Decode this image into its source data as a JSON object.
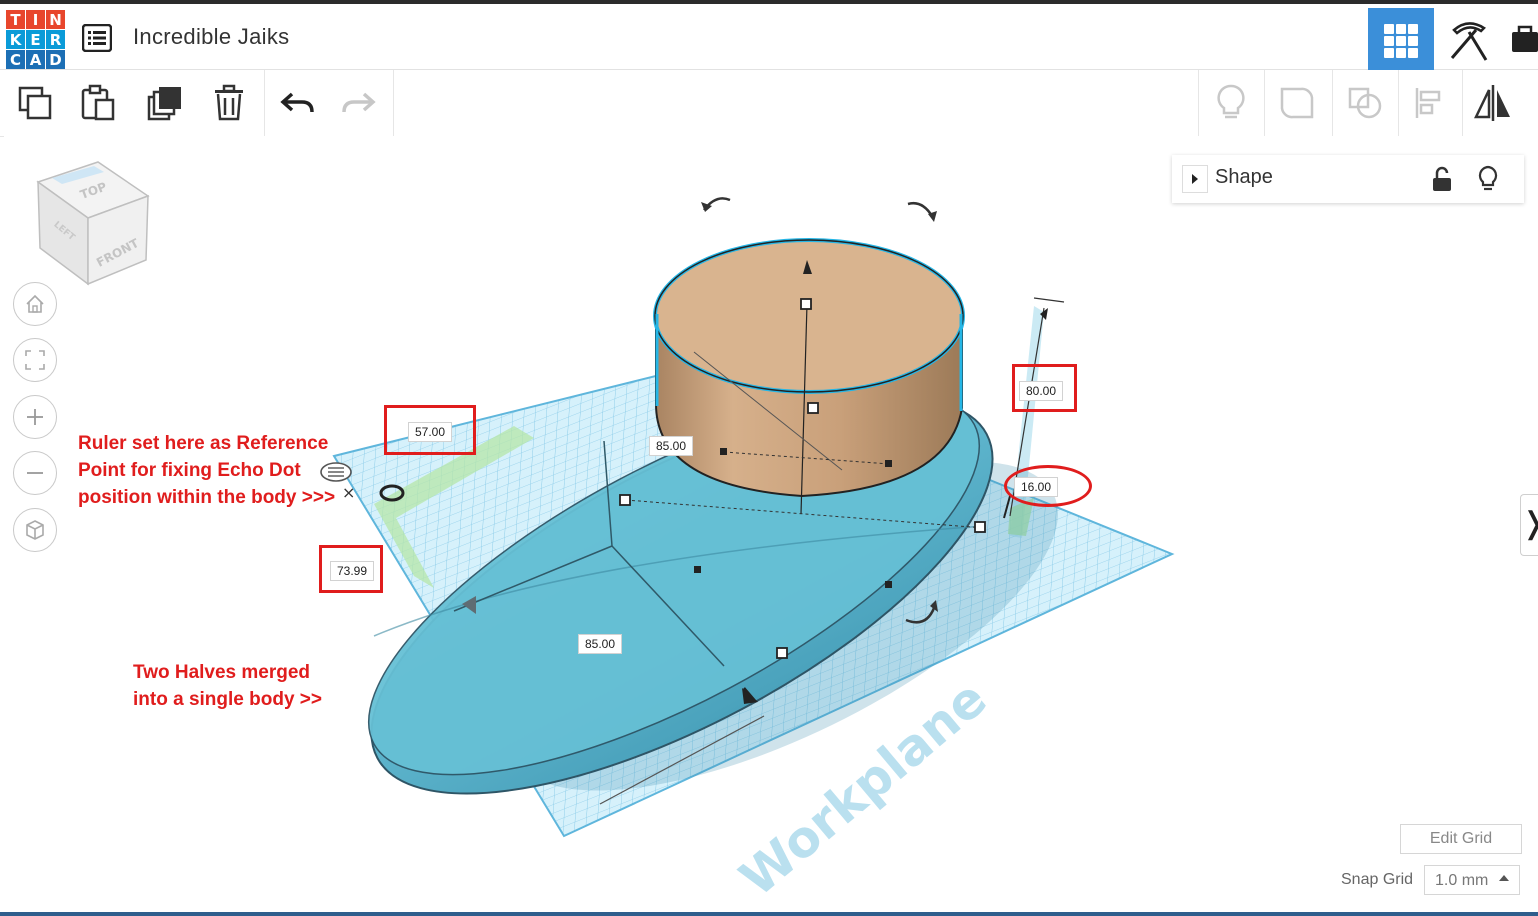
{
  "app": {
    "logo_letters": [
      "T",
      "I",
      "N",
      "K",
      "E",
      "R",
      "C",
      "A",
      "D"
    ],
    "logo_colors": [
      "#e8462c",
      "#e8462c",
      "#e8462c",
      "#0a9bd8",
      "#0a9bd8",
      "#0a9bd8",
      "#1c6fb5",
      "#1c6fb5",
      "#1c6fb5"
    ],
    "title": "Incredible Jaiks"
  },
  "header": {
    "design_list_icon": "list-icon",
    "grid_view_icon": "grid-view-icon",
    "pickaxe_icon": "pickaxe-icon"
  },
  "toolbar": {
    "left_tools": [
      "copy-icon",
      "paste-icon",
      "duplicate-icon",
      "delete-icon",
      "undo-icon",
      "redo-icon"
    ],
    "right_tools": [
      "lightbulb-icon",
      "group-icon",
      "ungroup-icon",
      "align-icon",
      "mirror-icon"
    ]
  },
  "view_cube": {
    "top": "TOP",
    "front": "FRONT",
    "left": "LEFT"
  },
  "nav_buttons": [
    "home-icon",
    "fit-view-icon",
    "zoom-in-icon",
    "zoom-out-icon",
    "perspective-icon"
  ],
  "shape_panel": {
    "title": "Shape"
  },
  "measurements": {
    "ruler_x": "57.00",
    "ruler_y": "73.99",
    "height": "80.00",
    "elevation": "16.00",
    "cyl_diameter": "85.00",
    "ellipse_width": "85.00"
  },
  "annotations": {
    "ruler_note": "Ruler set here as Reference\nPoint for fixing Echo Dot\nposition within the body >>>",
    "merge_note": "Two Halves merged\ninto a single body >>"
  },
  "workplane": {
    "label": "Workplane"
  },
  "grid_controls": {
    "edit_grid": "Edit Grid",
    "snap_label": "Snap Grid",
    "snap_value": "1.0 mm"
  },
  "colors": {
    "accent": "#3b8fd9",
    "annotation_red": "#e01d1d",
    "shape_blue": "#5fbcd3",
    "cylinder_tan": "#d9b48f"
  }
}
